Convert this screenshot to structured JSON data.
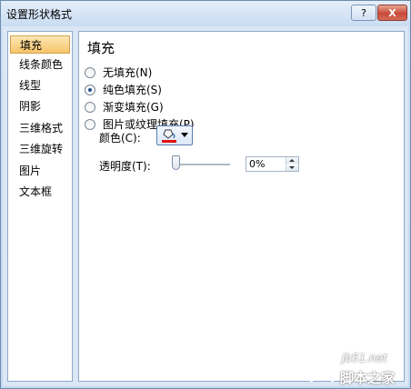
{
  "window": {
    "title": "设置形状格式",
    "help_label": "?",
    "close_label": "X"
  },
  "sidebar": {
    "items": [
      {
        "label": "填充",
        "selected": true
      },
      {
        "label": "线条颜色",
        "selected": false
      },
      {
        "label": "线型",
        "selected": false
      },
      {
        "label": "阴影",
        "selected": false
      },
      {
        "label": "三维格式",
        "selected": false
      },
      {
        "label": "三维旋转",
        "selected": false
      },
      {
        "label": "图片",
        "selected": false
      },
      {
        "label": "文本框",
        "selected": false
      }
    ]
  },
  "fill": {
    "title": "填充",
    "options": [
      {
        "label": "无填充(N)",
        "checked": false
      },
      {
        "label": "纯色填充(S)",
        "checked": true
      },
      {
        "label": "渐变填充(G)",
        "checked": false
      },
      {
        "label": "图片或纹理填充(P)",
        "checked": false
      }
    ],
    "color_label": "颜色(C):",
    "color_value": "#e01010",
    "transparency_label": "透明度(T):",
    "transparency_value": "0%",
    "transparency_fraction": 0
  },
  "watermark": {
    "site": "jb51.net",
    "name": "脚本之家"
  }
}
